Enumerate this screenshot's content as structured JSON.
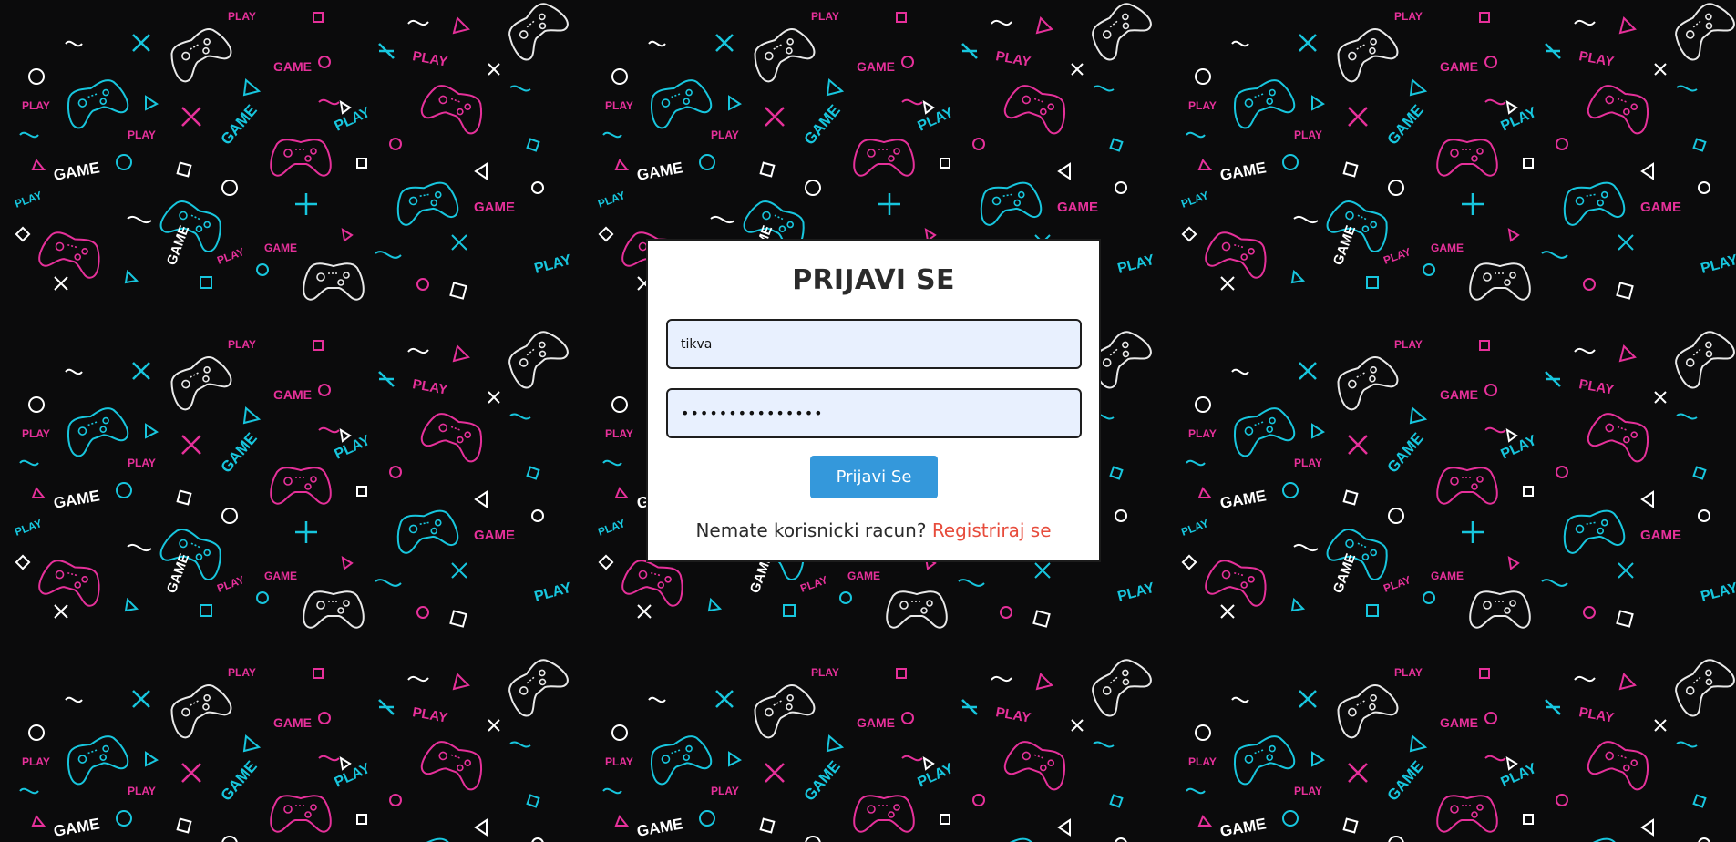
{
  "login": {
    "title": "PRIJAVI SE",
    "username_value": "tikva",
    "password_value": "•••••••••••••••",
    "submit_label": "Prijavi Se",
    "no_account_text": "Nemate korisnicki racun?",
    "register_link_label": "Registriraj se"
  },
  "background": {
    "words": [
      "GAME",
      "PLAY"
    ],
    "icons": [
      "gamepad-icon",
      "circle-icon",
      "triangle-icon",
      "square-icon",
      "cross-icon",
      "squiggle-icon"
    ]
  },
  "colors": {
    "page_background": "#0b0b0c",
    "pattern_cyan": "#17c6de",
    "pattern_pink": "#e6309a",
    "pattern_white": "#e9e9e9",
    "card_background": "#ffffff",
    "input_background": "#e8f0fe",
    "button": "#3498db",
    "register_link": "#e74c3c"
  }
}
